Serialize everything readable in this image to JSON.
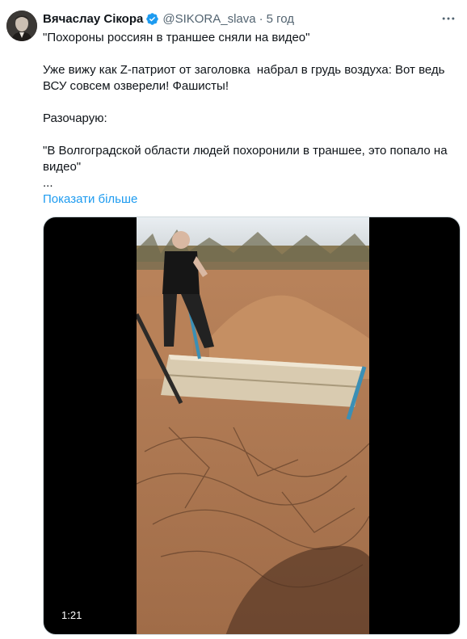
{
  "tweet": {
    "author_name": "Вячаслау Сікора",
    "handle": "@SIKORA_slava",
    "separator": "·",
    "time": "5 год",
    "paragraphs": [
      "\"Похороны россиян в траншее сняли на видео\"",
      "Уже вижу как Z-патриот от заголовка  набрал в грудь воздуха: Вот ведь ВСУ совсем озверели! Фашисты!",
      "Разочарую:",
      "\"В Волгоградской области людей похоронили в траншее, это попало на видео\"\n..."
    ],
    "show_more": "Показати більше"
  },
  "media": {
    "type": "video",
    "duration": "1:21"
  },
  "icons": {
    "verified": "verified-badge-icon",
    "more": "more-options-icon"
  },
  "colors": {
    "link": "#1d9bf0",
    "secondary_text": "#536471",
    "primary_text": "#0f1419"
  }
}
